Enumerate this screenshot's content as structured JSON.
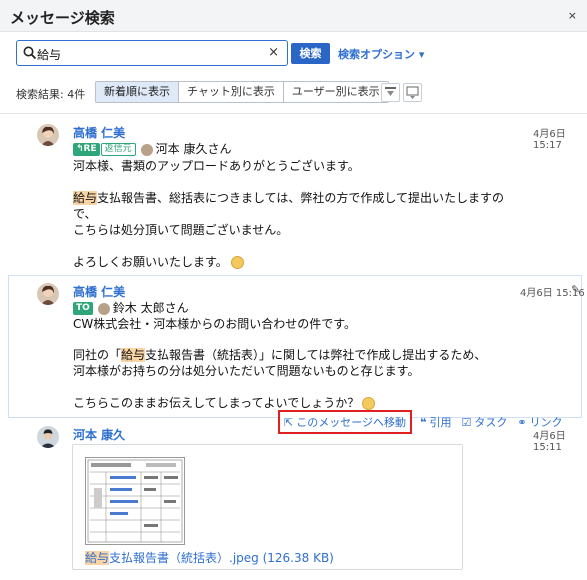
{
  "window": {
    "title": "メッセージ検索",
    "close_label": "×"
  },
  "search": {
    "query": "給与",
    "clear_label": "×",
    "button_label": "検索",
    "options_label": "検索オプション ▾"
  },
  "results": {
    "count_label": "検索結果: 4件"
  },
  "view_tabs": [
    {
      "label": "新着順に表示",
      "active": true
    },
    {
      "label": "チャット別に表示",
      "active": false
    },
    {
      "label": "ユーザー別に表示",
      "active": false
    }
  ],
  "messages": [
    {
      "sender": "高橋 仁美",
      "timestamp": "4月6日 15:17",
      "tag": "RE",
      "tag_sub": "返信元",
      "reply_to": "河本 康久さん",
      "lines": {
        "l1": "河本様、書類のアップロードありがとうございます。",
        "l2_hl": "給与",
        "l2_rest": "支払報告書、総括表につきましては、弊社の方で作成して提出いたしますの",
        "l3": "で、",
        "l4": "こちらは処分頂いて問題ございません。",
        "l5": "よろしくお願いいたします。"
      }
    },
    {
      "sender": "高橋 仁美",
      "timestamp": "4月6日 15:16",
      "tag": "TO",
      "to": "鈴木 太郎さん",
      "lines": {
        "l1": "CW株式会社・河本様からのお問い合わせの件です。",
        "l2_pre": "同社の「",
        "l2_hl": "給与",
        "l2_rest": "支払報告書（統括表）」に関しては弊社で作成し提出するため、",
        "l3": "河本様がお持ちの分は処分いただいて問題ないものと存じます。",
        "l4": "こちらこのままお伝えしてしまってよいでしょうか？"
      }
    },
    {
      "sender": "河本 康久",
      "timestamp": "4月6日 15:11",
      "file_hl": "給与",
      "file_rest": "支払報告書（統括表）.jpeg (126.38 KB)"
    }
  ],
  "actions": {
    "move": "このメッセージへ移動",
    "quote": "引用",
    "task": "タスク",
    "link": "リンク"
  },
  "colors": {
    "accent": "#2966c6",
    "highlight": "#f8d4a5",
    "tag_green": "#2fa67a",
    "move_border": "#e02020"
  }
}
